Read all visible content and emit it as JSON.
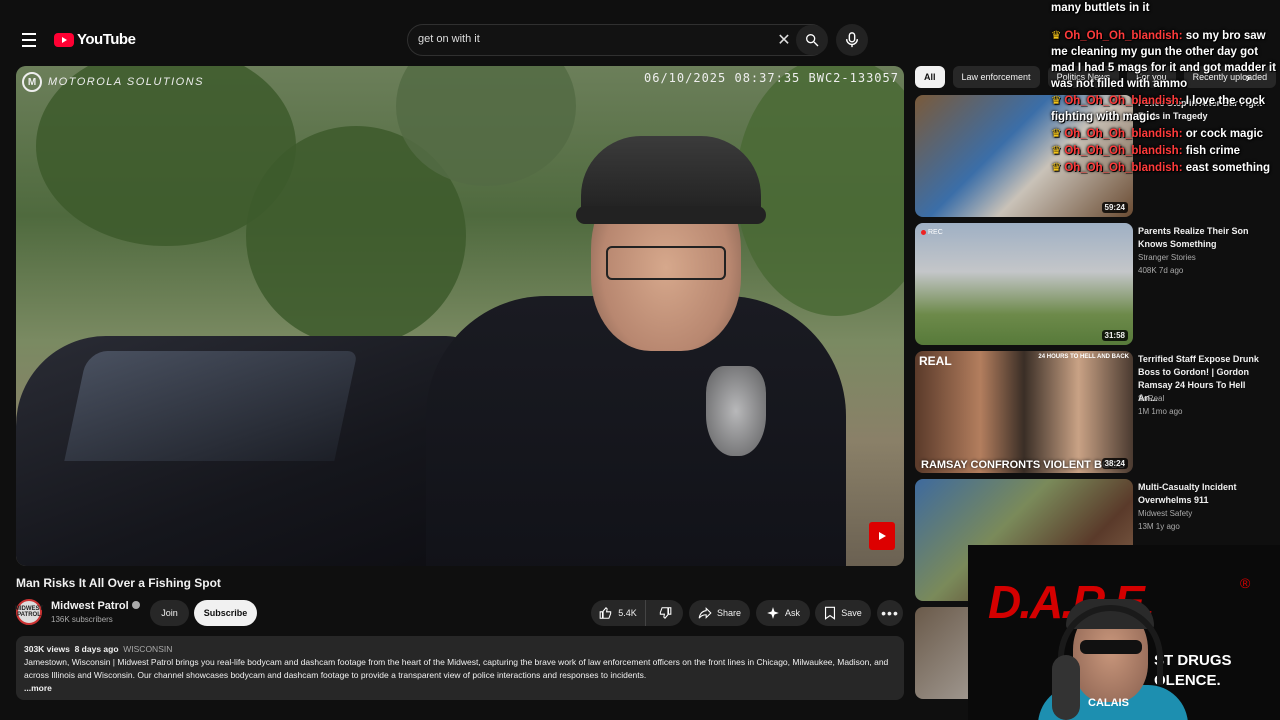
{
  "header": {
    "logo_text": "YouTube",
    "search_value": "get on with it"
  },
  "player": {
    "brand_overlay": "MOTOROLA SOLUTIONS",
    "timestamp_overlay": "06/10/2025 08:37:35  BWC2-133057"
  },
  "video": {
    "title": "Man Risks It All Over a Fishing Spot",
    "channel_name": "Midwest Patrol",
    "channel_avatar_text": "MIDWEST PATROL",
    "subscribers": "136K subscribers",
    "join_label": "Join",
    "subscribe_label": "Subscribe",
    "like_count": "5.4K",
    "share_label": "Share",
    "ask_label": "Ask",
    "save_label": "Save",
    "views": "303K views",
    "age": "8 days ago",
    "location_tag": "WISCONSIN",
    "description": "Jamestown, Wisconsin | Midwest Patrol brings you real-life bodycam and dashcam footage from the heart of the Midwest, capturing the brave work of law enforcement officers on the front lines in Chicago, Milwaukee, Madison, and across Illinois and Wisconsin. Our channel showcases bodycam and dashcam footage to provide a transparent view of police interactions and responses to incidents.",
    "more_label": "...more"
  },
  "chips": [
    "All",
    "Law enforcement",
    "Politics News",
    "For you",
    "Recently uploaded"
  ],
  "recommendations": [
    {
      "title": "Police Step in After Bar Fight Ends in Tragedy",
      "channel": "",
      "meta": "",
      "duration": "59:24",
      "thumb_text": ""
    },
    {
      "title": "Parents Realize Their Son Knows Something",
      "channel": "Stranger Stories",
      "meta": "408K  7d ago",
      "duration": "31:58",
      "thumb_text": "",
      "badge": "REC"
    },
    {
      "title": "Terrified Staff Expose Drunk Boss to Gordon! | Gordon Ramsay 24 Hours To Hell An...",
      "channel": "SoReal",
      "meta": "1M  1mo ago",
      "duration": "38:24",
      "thumb_text": "RAMSAY CONFRONTS VIOLENT BOSS",
      "badge": "REAL",
      "corner_text": "24 HOURS TO HELL AND BACK"
    },
    {
      "title": "Multi-Casualty Incident Overwhelms 911",
      "channel": "Midwest Safety",
      "meta": "13M  1y ago",
      "duration": "",
      "thumb_text": ""
    }
  ],
  "chat": [
    {
      "user": "",
      "text": "many buttlets in it"
    },
    {
      "user": "Oh_Oh_Oh_blandish:",
      "text": "so my bro saw me cleaning my gun the other day got mad I had 5 mags for it and got madder it was not filled with ammo"
    },
    {
      "user": "Oh_Oh_Oh_blandish:",
      "text": "I love the cock fighting with magic"
    },
    {
      "user": "Oh_Oh_Oh_blandish:",
      "text": "or cock magic"
    },
    {
      "user": "Oh_Oh_Oh_blandish:",
      "text": "fish crime"
    },
    {
      "user": "Oh_Oh_Oh_blandish:",
      "text": "east something"
    }
  ],
  "webcam": {
    "brand": "D.A.R.E.",
    "registered": "®",
    "slogan_line1": "ST DRUGS",
    "slogan_line2": "OLENCE.",
    "shirt_text": "CALAIS"
  },
  "icons": [
    "menu-icon",
    "youtube-logo-icon",
    "close-icon",
    "search-icon",
    "mic-icon",
    "like-icon",
    "dislike-icon",
    "share-icon",
    "ask-sparkle-icon",
    "save-icon",
    "more-icon",
    "verified-icon",
    "chevron-right-icon"
  ],
  "colors": {
    "background": "#0f0f0f",
    "brand_red": "#ff0033",
    "chat_user": "#ff3b3b",
    "pill": "#272727"
  }
}
